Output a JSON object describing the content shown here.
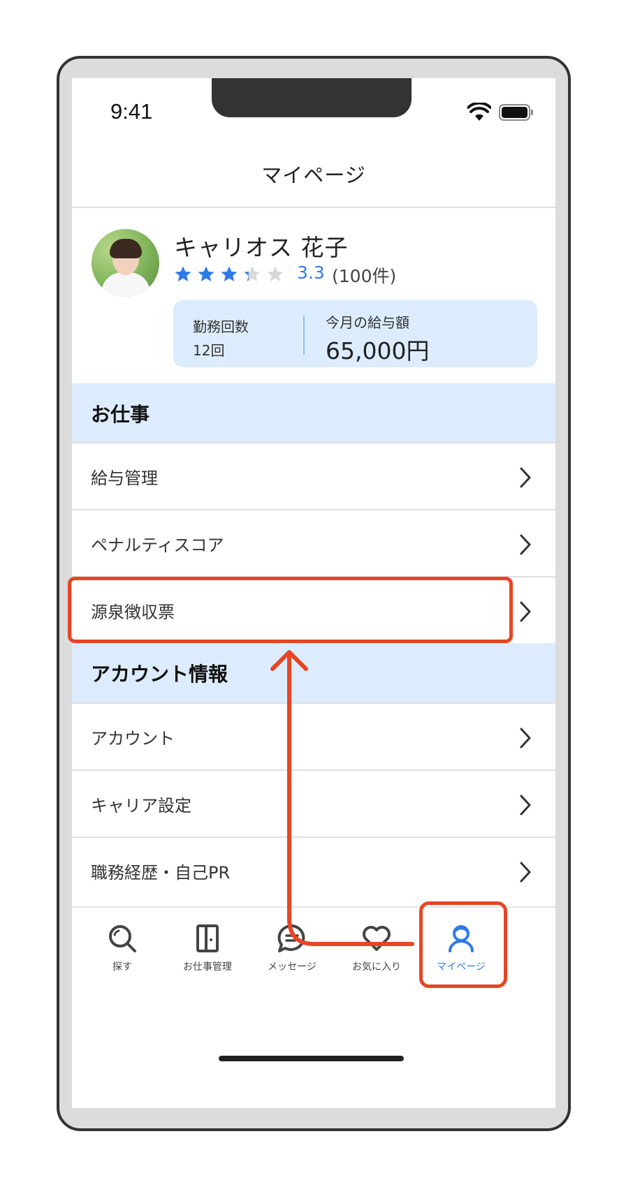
{
  "status_bar": {
    "time": "9:41"
  },
  "header": {
    "title": "マイページ"
  },
  "profile": {
    "name": "キャリオス 花子",
    "rating": 3.3,
    "rating_text": "3.3",
    "rating_count": "(100件)",
    "stars_max": 5
  },
  "stats": {
    "work_count_label": "勤務回数",
    "work_count_value": "12回",
    "salary_label": "今月の給与額",
    "salary_value": "65,000円"
  },
  "sections": [
    {
      "title": "お仕事",
      "items": [
        "給与管理",
        "ペナルティスコア",
        "源泉徴収票"
      ]
    },
    {
      "title": "アカウント情報",
      "items": [
        "アカウント",
        "キャリア設定",
        "職務経歴・自己PR"
      ]
    }
  ],
  "tab_bar": {
    "tabs": [
      {
        "label": "探す",
        "icon": "search-icon"
      },
      {
        "label": "お仕事管理",
        "icon": "door-icon"
      },
      {
        "label": "メッセージ",
        "icon": "message-icon"
      },
      {
        "label": "お気に入り",
        "icon": "heart-icon"
      },
      {
        "label": "マイページ",
        "icon": "person-icon",
        "active": true
      }
    ]
  },
  "colors": {
    "accent": "#2f7be6",
    "section_bg": "#ddecfc",
    "highlight": "#e84524",
    "star_empty": "#d8d8d8"
  }
}
